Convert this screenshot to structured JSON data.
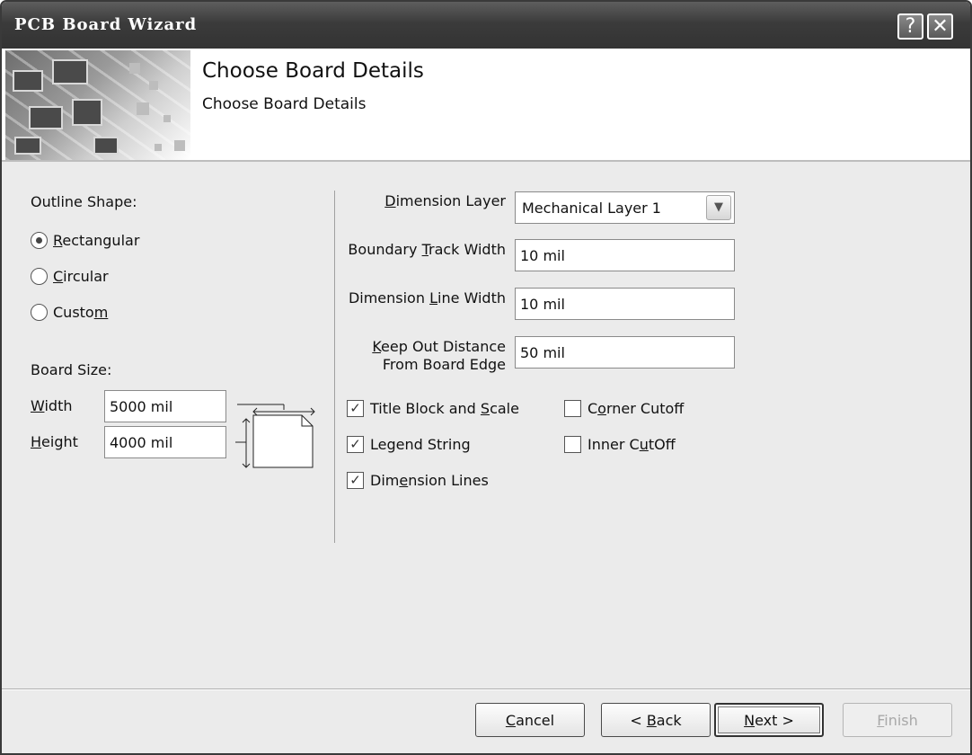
{
  "window": {
    "title": "PCB Board Wizard",
    "help_glyph": "?",
    "close_glyph": "✕"
  },
  "header": {
    "title": "Choose Board Details",
    "subtitle": "Choose Board Details",
    "art_icon": "circuit-board-icon"
  },
  "outline": {
    "label": "Outline Shape:",
    "options": [
      {
        "pre": "",
        "key": "R",
        "post": "ectangular",
        "selected": true
      },
      {
        "pre": "",
        "key": "C",
        "post": "ircular",
        "selected": false
      },
      {
        "pre": "Custo",
        "key": "m",
        "post": "",
        "selected": false
      }
    ]
  },
  "board_size": {
    "label": "Board Size:",
    "width": {
      "key": "W",
      "rest": "idth",
      "value": "5000 mil"
    },
    "height": {
      "key": "H",
      "rest": "eight",
      "value": "4000 mil"
    }
  },
  "layer": {
    "dimension_layer": {
      "key": "D",
      "rest": "imension Layer",
      "value": "Mechanical Layer 1"
    },
    "boundary_track_width": {
      "pre": "Boundary ",
      "key": "T",
      "post": "rack Width",
      "value": "10 mil"
    },
    "dimension_line_width": {
      "pre": "Dimension ",
      "key": "L",
      "post": "ine Width",
      "value": "10 mil"
    },
    "keep_out": {
      "key": "K",
      "line1_rest": "eep Out Distance",
      "line2": "From Board Edge",
      "value": "50 mil"
    }
  },
  "checks": {
    "title_block": {
      "pre": "Title Block and ",
      "key": "S",
      "post": "cale",
      "checked": true
    },
    "legend_string": {
      "pre": "Legend String",
      "key": "",
      "post": "",
      "checked": true
    },
    "dimension_lines": {
      "pre": "Dim",
      "key": "e",
      "post": "nsion Lines",
      "checked": true
    },
    "corner_cutoff": {
      "pre": "C",
      "key": "o",
      "post": "rner Cutoff",
      "checked": false
    },
    "inner_cutoff": {
      "pre": "Inner C",
      "key": "u",
      "post": "tOff",
      "checked": false
    }
  },
  "buttons": {
    "cancel": {
      "pre": "",
      "key": "C",
      "post": "ancel"
    },
    "back": {
      "pre": "< ",
      "key": "B",
      "post": "ack"
    },
    "next": {
      "pre": "",
      "key": "N",
      "post": "ext >"
    },
    "finish": {
      "pre": "",
      "key": "F",
      "post": "inish"
    }
  }
}
